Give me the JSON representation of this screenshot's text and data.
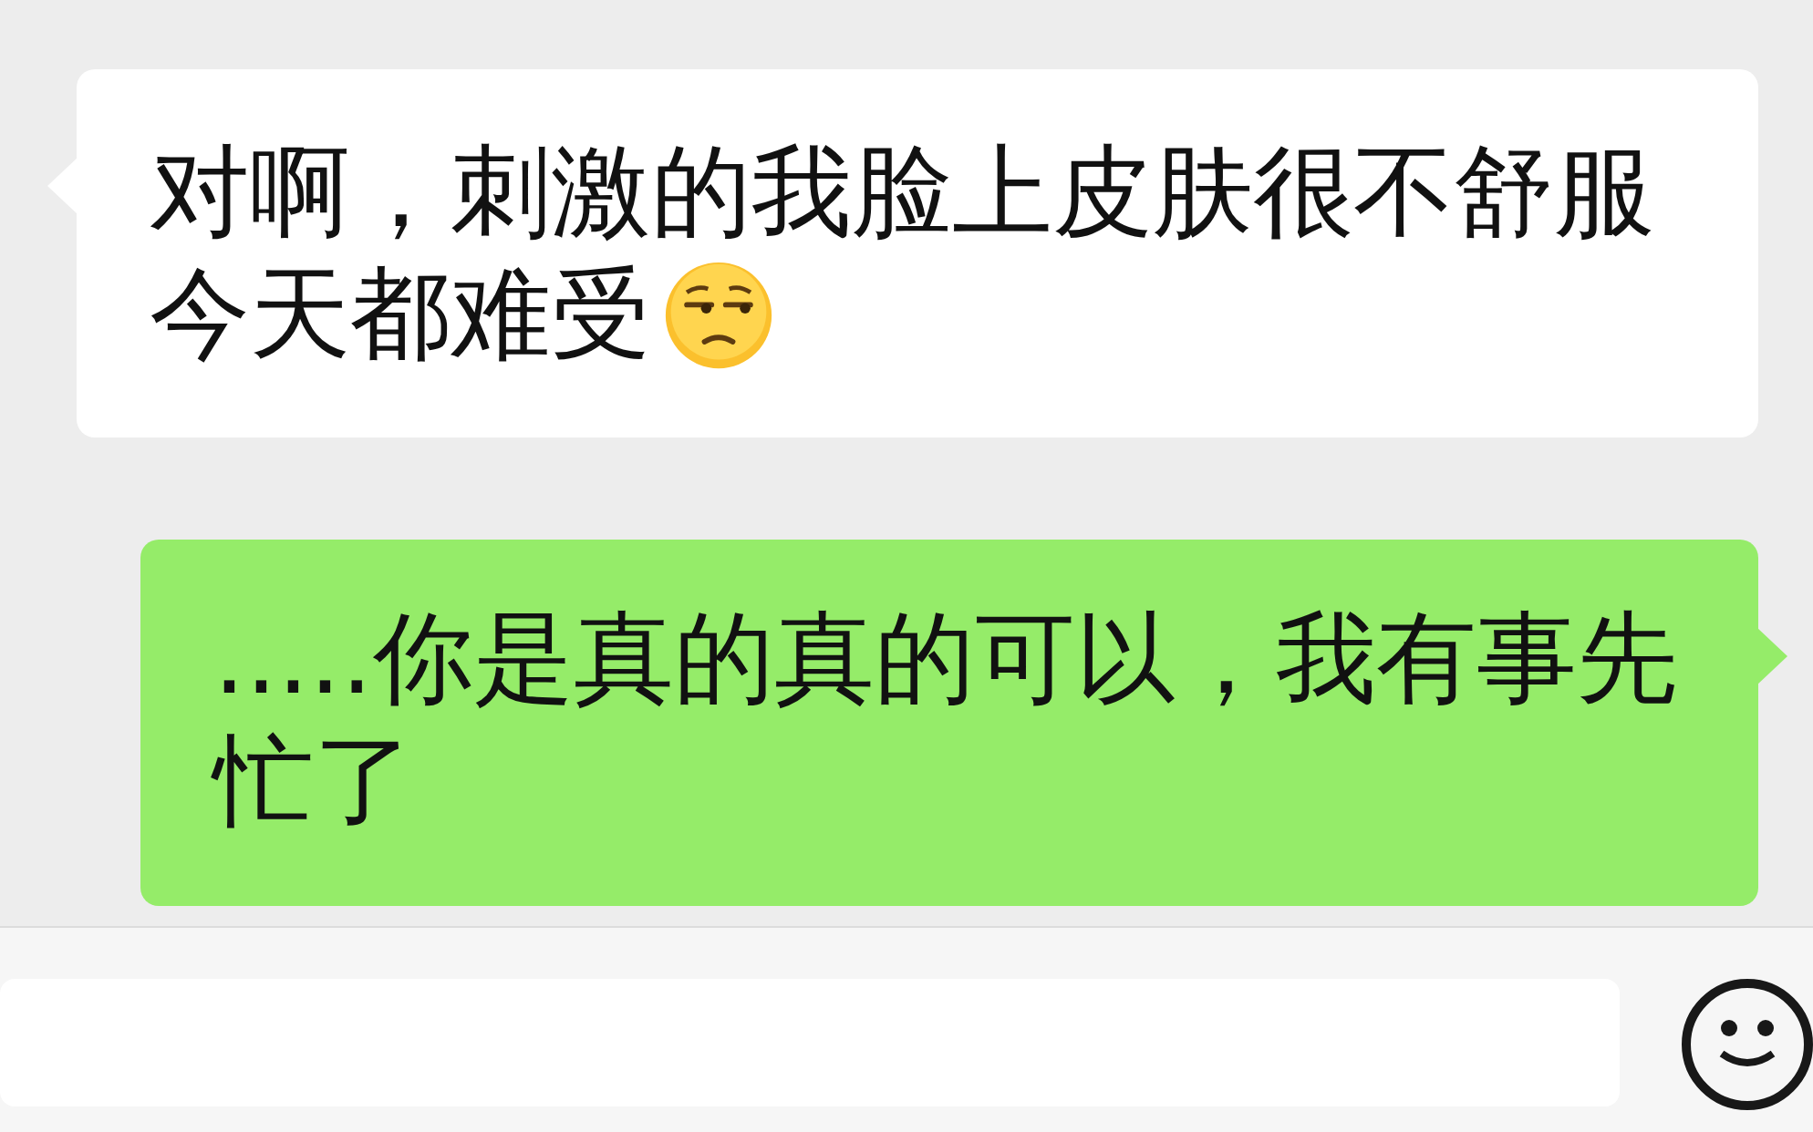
{
  "messages": [
    {
      "kind": "received",
      "lines": [
        "对啊，刺激的我脸上皮肤很不舒服",
        "今天都难受"
      ],
      "emoji": true
    },
    {
      "kind": "sent",
      "lines": [
        ".....你是真的真的可以，我有事先",
        "忙了"
      ],
      "emoji": false
    }
  ]
}
